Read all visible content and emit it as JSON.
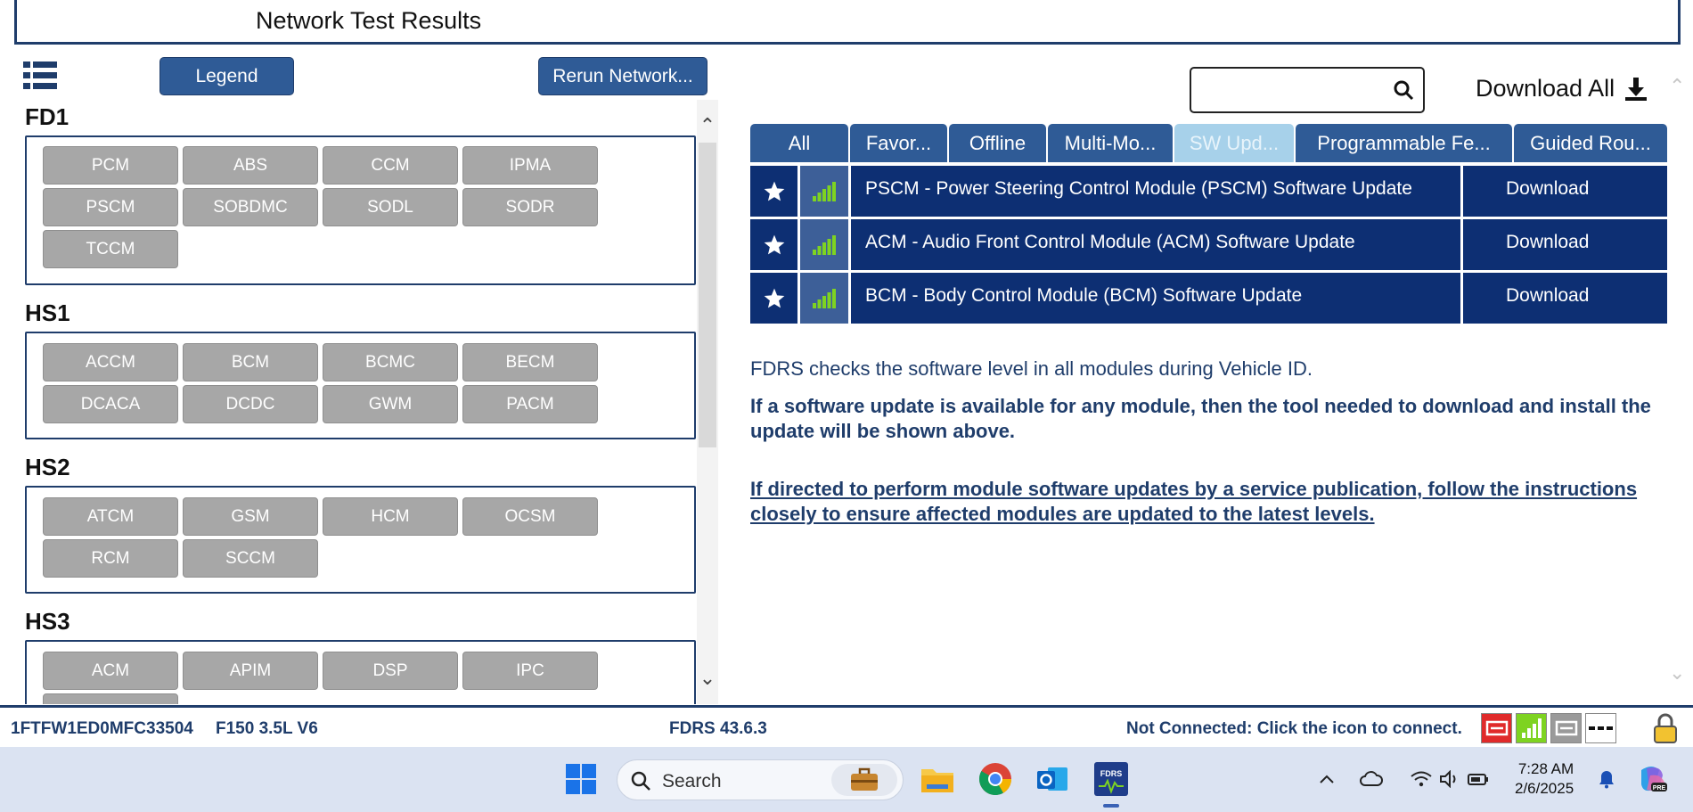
{
  "window": {
    "title": "Network Test Results"
  },
  "left_panel": {
    "legend_label": "Legend",
    "rerun_label": "Rerun Network...",
    "groups": [
      {
        "name": "FD1",
        "modules": [
          "PCM",
          "ABS",
          "CCM",
          "IPMA",
          "PSCM",
          "SOBDMC",
          "SODL",
          "SODR",
          "TCCM"
        ]
      },
      {
        "name": "HS1",
        "modules": [
          "ACCM",
          "BCM",
          "BCMC",
          "BECM",
          "DCACA",
          "DCDC",
          "GWM",
          "PACM"
        ]
      },
      {
        "name": "HS2",
        "modules": [
          "ATCM",
          "GSM",
          "HCM",
          "OCSM",
          "RCM",
          "SCCM"
        ]
      },
      {
        "name": "HS3",
        "modules": [
          "ACM",
          "APIM",
          "DSP",
          "IPC"
        ]
      }
    ]
  },
  "right_panel": {
    "search": {
      "placeholder": "",
      "value": ""
    },
    "download_all_label": "Download All",
    "tabs": [
      {
        "label": "All",
        "active": false
      },
      {
        "label": "Favor...",
        "active": false
      },
      {
        "label": "Offline",
        "active": false
      },
      {
        "label": "Multi-Mo...",
        "active": false
      },
      {
        "label": "SW Upd...",
        "active": true
      },
      {
        "label": "Programmable Fe...",
        "active": false
      },
      {
        "label": "Guided Rou...",
        "active": false
      }
    ],
    "updates": [
      {
        "description": "PSCM - Power Steering Control Module (PSCM) Software Update",
        "action": "Download"
      },
      {
        "description": "ACM - Audio Front Control Module (ACM) Software Update",
        "action": "Download"
      },
      {
        "description": "BCM - Body Control Module (BCM) Software Update",
        "action": "Download"
      }
    ],
    "info_text": "FDRS checks the software level in all modules during Vehicle ID.",
    "info_bold": "If a software update is available for any module, then the tool needed to download and install the update will be shown above.",
    "info_link": "If directed to perform module software updates by a service publication, follow the instructions closely to ensure affected modules are updated to the latest levels."
  },
  "status_bar": {
    "vin": "1FTFW1ED0MFC33504",
    "vehicle": "F150 3.5L V6",
    "version": "FDRS 43.6.3",
    "connection": "Not Connected: Click the icon to connect."
  },
  "taskbar": {
    "search_label": "Search",
    "time": "7:28 AM",
    "date": "2/6/2025",
    "fdrs_label": "FDRS"
  },
  "colors": {
    "navy": "#0d2f73",
    "button_blue": "#2f5b96",
    "module_gray": "#a7a7a7",
    "active_tab": "#a7d1ea",
    "signal_green": "#7ed321",
    "disconnected_red": "#e02a2a"
  }
}
